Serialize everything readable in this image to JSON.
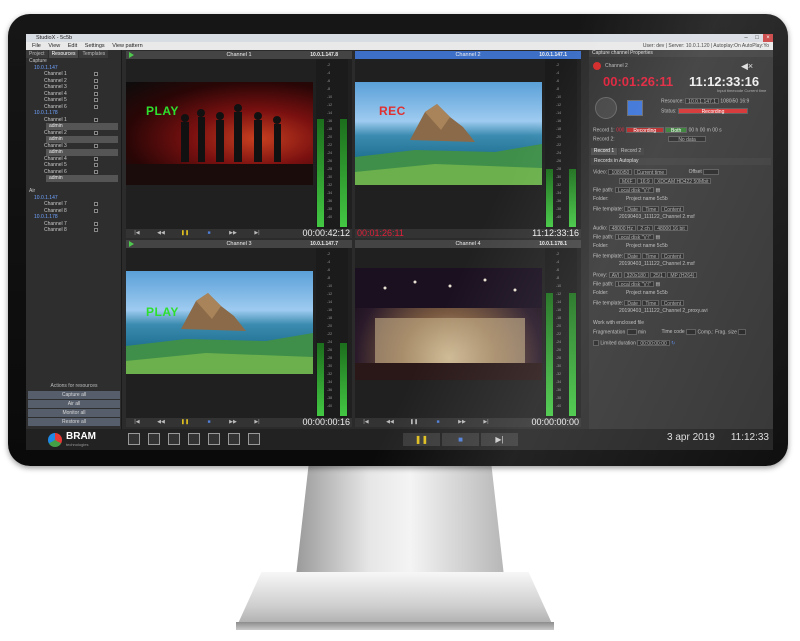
{
  "window": {
    "title": "StudioX - 5c5b",
    "user_info": "User: dev  |  Server: 10.0.1.120  |  Autoplay:On  AutoPlay:Yo"
  },
  "menu": [
    "File",
    "View",
    "Edit",
    "Settings",
    "View pattern"
  ],
  "left_panel": {
    "tabs": [
      "Project",
      "Resources",
      "Templates"
    ],
    "tree": [
      {
        "label": "Capture",
        "kind": "group"
      },
      {
        "label": "10.0.1.147",
        "kind": "ip"
      },
      {
        "label": "Channel 1",
        "kind": "item"
      },
      {
        "label": "Channel 2",
        "kind": "item"
      },
      {
        "label": "Channel 3",
        "kind": "item"
      },
      {
        "label": "Channel 4",
        "kind": "item"
      },
      {
        "label": "Channel 5",
        "kind": "item"
      },
      {
        "label": "Channel 6",
        "kind": "item"
      },
      {
        "label": "10.0.1.178",
        "kind": "ip"
      },
      {
        "label": "Channel 1",
        "kind": "item"
      },
      {
        "label": "admin",
        "kind": "sel"
      },
      {
        "label": "Channel 2",
        "kind": "item"
      },
      {
        "label": "admin",
        "kind": "sel"
      },
      {
        "label": "Channel 3",
        "kind": "item"
      },
      {
        "label": "admin",
        "kind": "sel"
      },
      {
        "label": "Channel 4",
        "kind": "item"
      },
      {
        "label": "Channel 5",
        "kind": "item"
      },
      {
        "label": "Channel 6",
        "kind": "item"
      },
      {
        "label": "admin",
        "kind": "sel"
      },
      {
        "label": "",
        "kind": "blank"
      },
      {
        "label": "Air",
        "kind": "group"
      },
      {
        "label": "10.0.1.147",
        "kind": "ip"
      },
      {
        "label": "Channel 7",
        "kind": "item"
      },
      {
        "label": "Channel 8",
        "kind": "item"
      },
      {
        "label": "10.0.1.178",
        "kind": "ip"
      },
      {
        "label": "Channel 7",
        "kind": "item"
      },
      {
        "label": "Channel 8",
        "kind": "item"
      }
    ],
    "actions_title": "Actions for resources",
    "actions": [
      "Capture all",
      "Air all",
      "Monitor all",
      "Restore all"
    ]
  },
  "channels": [
    {
      "name": "Channel 1",
      "ip": "10.0.1.147.8",
      "timecode": "00:00:42:12",
      "status_tag": "PLAY",
      "tag_color": "#2ee02e",
      "active": false
    },
    {
      "name": "Channel 2",
      "ip": "10.0.1.147.1",
      "timecode": "11:12:33:16",
      "rec_timecode": "00:01:26:11",
      "status_tag": "REC",
      "tag_color": "#e03030",
      "active": true
    },
    {
      "name": "Channel 3",
      "ip": "10.0.1.147.7",
      "timecode": "00:00:00:16",
      "status_tag": "PLAY",
      "tag_color": "#2ee02e",
      "active": false
    },
    {
      "name": "Channel 4",
      "ip": "10.0.1.178.1",
      "timecode": "00:00:00:00",
      "status_tag": "",
      "tag_color": "#2ee02e",
      "active": false
    }
  ],
  "meter_scale": [
    "-2",
    "-4",
    "-6",
    "-8",
    "-10",
    "-12",
    "-14",
    "-16",
    "-18",
    "-20",
    "-22",
    "-24",
    "-26",
    "-28",
    "-30",
    "-32",
    "-34",
    "-36",
    "-38",
    "-40"
  ],
  "right_panel": {
    "title": "Capture channel Properties",
    "channel": "Channel 2",
    "rec_time": "00:01:26:11",
    "current_time": "11:12:33:16",
    "current_time_label": "Input timecode Current time",
    "resource_label": "Resource:",
    "resource_value": "10.0.1.147.1",
    "resource_extra": "1080i50 16:9",
    "status_label": "Status:",
    "status_value": "Recording",
    "record1_label": "Record 1:",
    "record1_id": "000",
    "record1_status": "Recording",
    "record1_badge": "Both",
    "record1_dur": "00 h 00 m 00 s",
    "record2_label": "Record 2:",
    "record2_status": "No data",
    "tabs": [
      "Record 1",
      "Record 2"
    ],
    "section": "Records in Autoplay",
    "video_label": "Video:",
    "video_format": "1080i50",
    "video_tc": "Current time",
    "offset_label": "Offset",
    "video_codec": "MXF",
    "video_codec2": "16:9",
    "video_codec3": "XDCAM HD422 50Mbit",
    "filepath_label": "File path:",
    "filepath_value": "Local disk \"V:\\\"",
    "folder_label": "Folder:",
    "folder_value": "Project name  5c5b",
    "filetemplate_label": "File template:",
    "template_date": "Date",
    "template_time": "Time",
    "template_ch": "Content",
    "template_file1": "20190403_111122_Channel 2.mxf",
    "audio_label": "Audio:",
    "audio_fmt": "48000 Hz",
    "audio_ch": "2 ch",
    "audio_bits": "48000 16 bit",
    "template_file2": "20190403_111122_Channel 2.mxf",
    "proxy_label": "Proxy:",
    "proxy_fmt": "AVI",
    "proxy_res": "320x180",
    "proxy_fps": "25/1",
    "proxy_codec": "MP (H264)",
    "template_file3": "20190403_111122_Channel 2_proxy.avi",
    "locked_label": "Work with enclosed file",
    "frag_label": "Fragmentation",
    "frag_min": "min",
    "timecode_label": "Time code",
    "comp_label": "Comp.: Frag. size",
    "limited_label": "Limited duration",
    "limited_value": "00:00:00:00"
  },
  "bottom": {
    "brand": "BRAM",
    "brand_sub": "technologies",
    "date": "3 apr  2019",
    "clock": "11:12:33"
  }
}
